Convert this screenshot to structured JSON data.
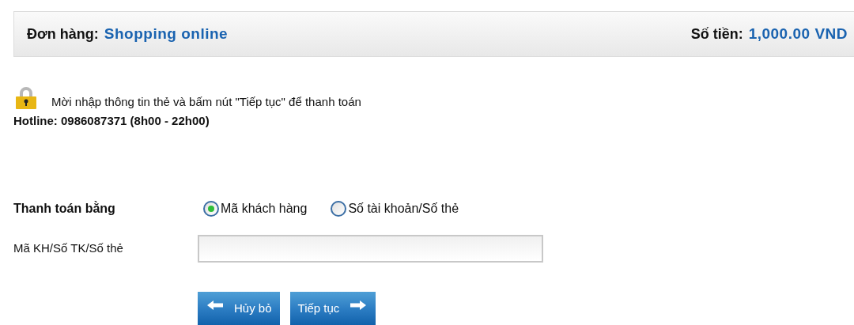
{
  "order": {
    "label": "Đơn hàng:",
    "value": "Shopping online"
  },
  "amount": {
    "label": "Số tiền:",
    "value": "1,000.00 VND"
  },
  "instruction": "Mời nhập thông tin thẻ và bấm nút \"Tiếp tục\" để thanh toán",
  "hotline": "Hotline: 0986087371 (8h00 - 22h00)",
  "payment_method": {
    "label": "Thanh toán bằng",
    "options": [
      {
        "label": "Mã khách hàng",
        "selected": true
      },
      {
        "label": "Số tài khoản/Số thẻ",
        "selected": false
      }
    ]
  },
  "card_field": {
    "label": "Mã KH/Số TK/Số thẻ"
  },
  "buttons": [
    {
      "kind": "back",
      "label": "Hủy bỏ"
    },
    {
      "kind": "next",
      "label": "Tiếp tục"
    }
  ]
}
